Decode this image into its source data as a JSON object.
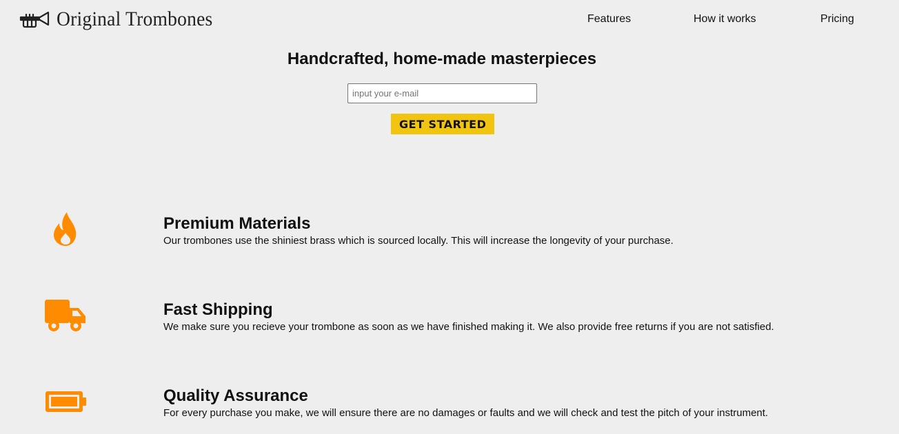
{
  "header": {
    "brand": "Original Trombones",
    "logo_icon": "trombone-icon",
    "nav": [
      {
        "label": "Features"
      },
      {
        "label": "How it works"
      },
      {
        "label": "Pricing"
      }
    ]
  },
  "hero": {
    "title": "Handcrafted, home-made masterpieces",
    "email_placeholder": "input your e-mail",
    "email_value": "",
    "cta_label": "GET STARTED"
  },
  "features": [
    {
      "icon": "fire-icon",
      "title": "Premium Materials",
      "description": "Our trombones use the shiniest brass which is sourced locally. This will increase the longevity of your purchase."
    },
    {
      "icon": "truck-icon",
      "title": "Fast Shipping",
      "description": "We make sure you recieve your trombone as soon as we have finished making it. We also provide free returns if you are not satisfied."
    },
    {
      "icon": "battery-icon",
      "title": "Quality Assurance",
      "description": "For every purchase you make, we will ensure there are no damages or faults and we will check and test the pitch of your instrument."
    }
  ],
  "colors": {
    "background": "#eeeeee",
    "accent": "#f1c40f",
    "icon": "#ff8c00"
  }
}
